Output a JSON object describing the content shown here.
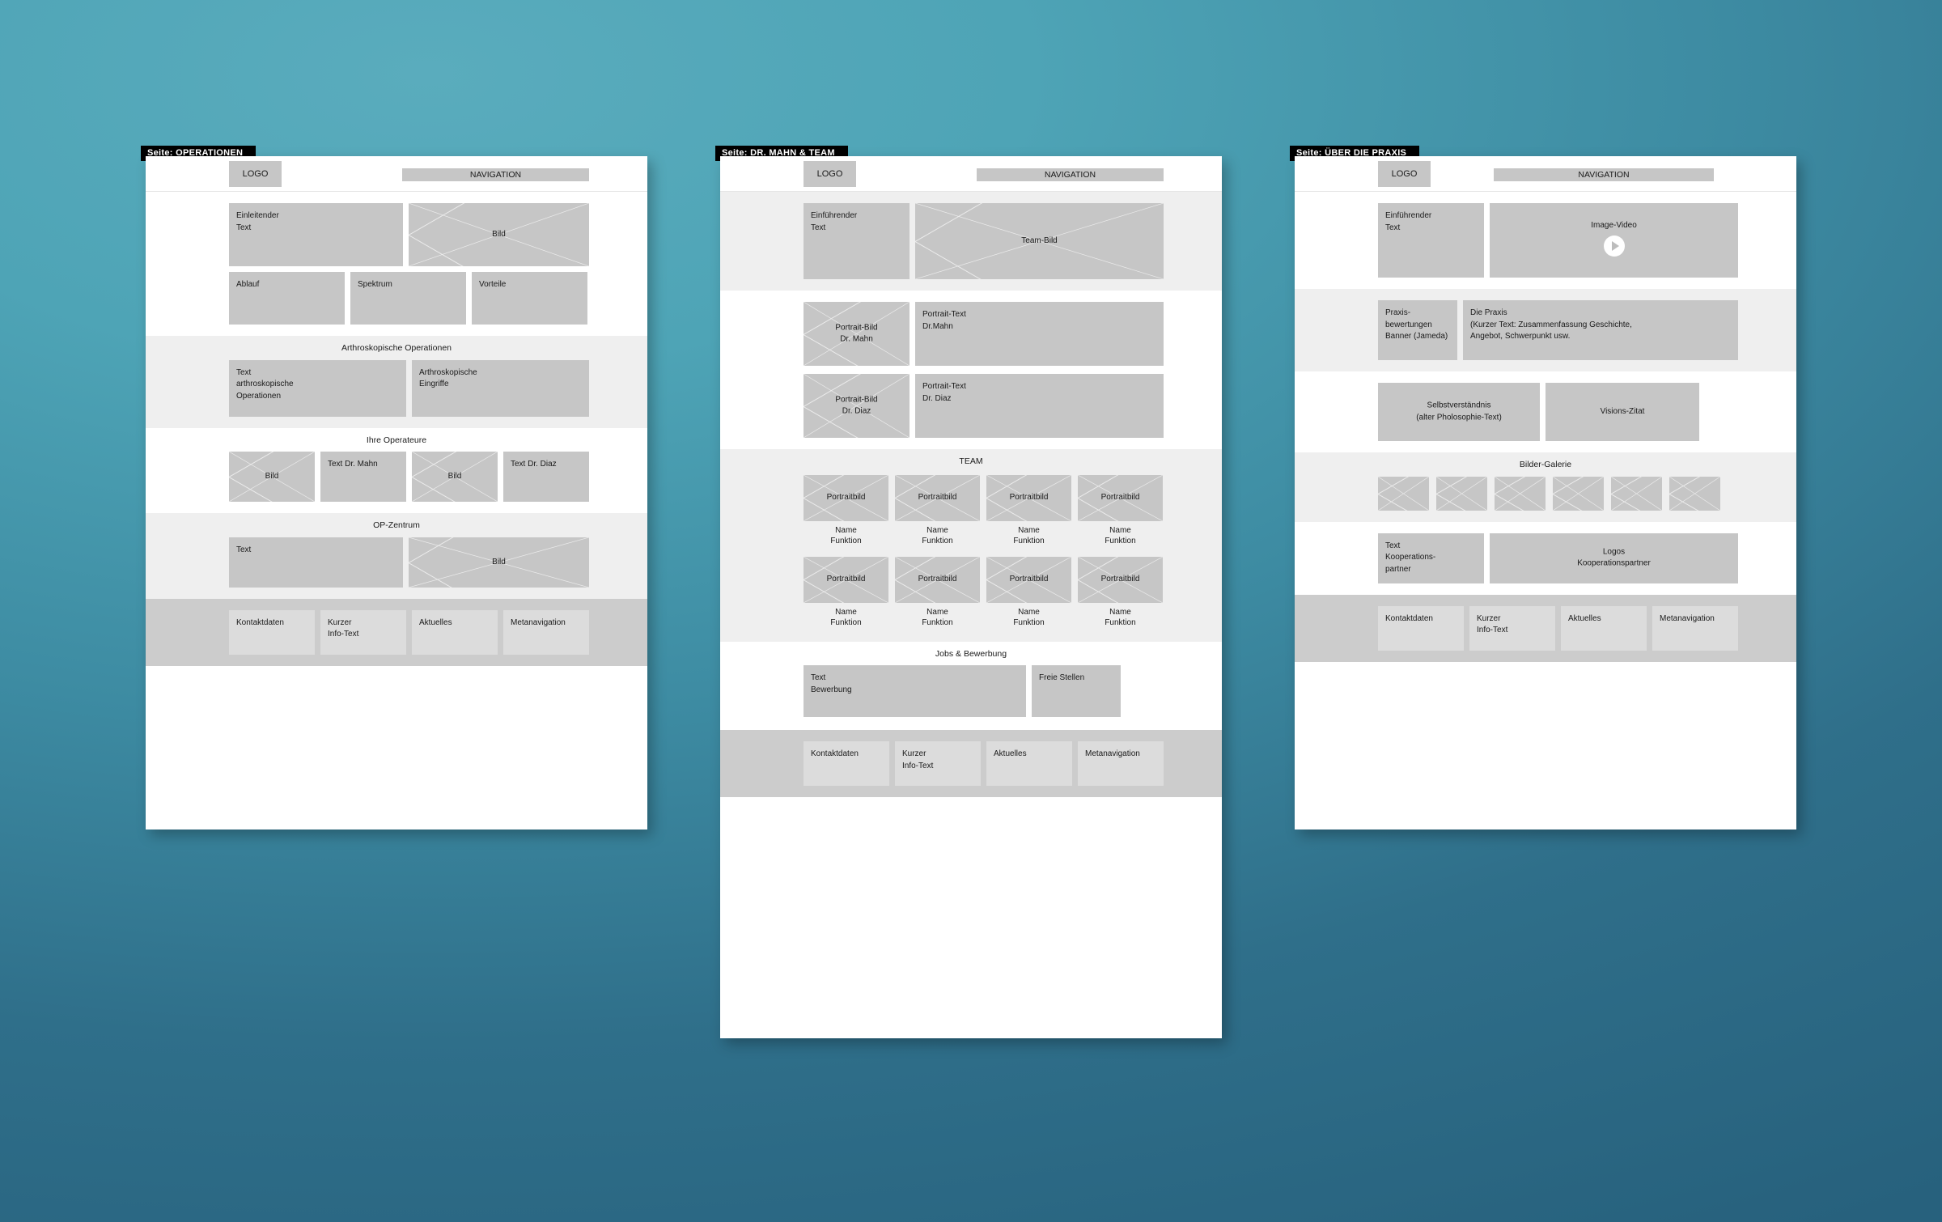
{
  "theme": {
    "background_top": "#4ea4b6",
    "background_bottom": "#27617d",
    "block_fill": "#c6c6c6",
    "band_grey": "#efefef",
    "footer_grey": "#cccccc",
    "tag_bg": "#000000"
  },
  "common": {
    "tag_prefix": "Seite:",
    "logo": "LOGO",
    "navigation": "NAVIGATION",
    "footer": [
      {
        "label": "Kontaktdaten"
      },
      {
        "label": "Kurzer\nInfo-Text"
      },
      {
        "label": "Aktuelles"
      },
      {
        "label": "Metanavigation"
      }
    ]
  },
  "boards": [
    {
      "id": "operationen",
      "tag": "OPERATIONEN",
      "sections": [
        {
          "id": "intro",
          "band": "white",
          "title": "",
          "rows": [
            {
              "blocks": [
                {
                  "label": "Einleitender\nText",
                  "type": "text",
                  "align": "topleft"
                },
                {
                  "label": "Bild",
                  "type": "image",
                  "align": "center"
                }
              ]
            },
            {
              "blocks": [
                {
                  "label": "Ablauf",
                  "type": "text",
                  "align": "topleft"
                },
                {
                  "label": "Spektrum",
                  "type": "text",
                  "align": "topleft"
                },
                {
                  "label": "Vorteile",
                  "type": "text",
                  "align": "topleft"
                }
              ]
            }
          ]
        },
        {
          "id": "arthroskopische-operationen",
          "band": "grey",
          "title": "Arthroskopische Operationen",
          "rows": [
            {
              "blocks": [
                {
                  "label": "Text\narthroskopische\nOperationen",
                  "type": "text",
                  "align": "topleft"
                },
                {
                  "label": "Arthroskopische\nEingriffe",
                  "type": "text",
                  "align": "topleft"
                }
              ]
            }
          ]
        },
        {
          "id": "ihre-operateure",
          "band": "white",
          "title": "Ihre Operateure",
          "rows": [
            {
              "blocks": [
                {
                  "label": "Bild",
                  "type": "image",
                  "align": "center"
                },
                {
                  "label": "Text Dr. Mahn",
                  "type": "text",
                  "align": "topleft"
                },
                {
                  "label": "Bild",
                  "type": "image",
                  "align": "center"
                },
                {
                  "label": "Text Dr. Diaz",
                  "type": "text",
                  "align": "topleft"
                }
              ]
            }
          ]
        },
        {
          "id": "op-zentrum",
          "band": "grey",
          "title": "OP-Zentrum",
          "rows": [
            {
              "blocks": [
                {
                  "label": "Text",
                  "type": "text",
                  "align": "topleft"
                },
                {
                  "label": "Bild",
                  "type": "image",
                  "align": "center"
                }
              ]
            }
          ]
        }
      ]
    },
    {
      "id": "dr-mahn-team",
      "tag": "DR. MAHN & TEAM",
      "sections": [
        {
          "id": "einfuehrung",
          "band": "grey",
          "title": "",
          "rows": [
            {
              "blocks": [
                {
                  "label": "Einführender\nText",
                  "type": "text",
                  "align": "topleft"
                },
                {
                  "label": "Team-Bild",
                  "type": "image",
                  "align": "center"
                }
              ]
            }
          ]
        },
        {
          "id": "portraits",
          "band": "white",
          "title": "",
          "rows": [
            {
              "blocks": [
                {
                  "label": "Portrait-Bild\nDr. Mahn",
                  "type": "image",
                  "align": "center"
                },
                {
                  "label": "Portrait-Text\nDr.Mahn",
                  "type": "text",
                  "align": "topleft"
                }
              ]
            },
            {
              "blocks": [
                {
                  "label": "Portrait-Bild\nDr. Diaz",
                  "type": "image",
                  "align": "center"
                },
                {
                  "label": "Portrait-Text\nDr. Diaz",
                  "type": "text",
                  "align": "topleft"
                }
              ]
            }
          ]
        },
        {
          "id": "team",
          "band": "grey",
          "title": "TEAM",
          "team_rows": [
            [
              {
                "image_label": "Portraitbild",
                "caption": "Name\nFunktion"
              },
              {
                "image_label": "Portraitbild",
                "caption": "Name\nFunktion"
              },
              {
                "image_label": "Portraitbild",
                "caption": "Name\nFunktion"
              },
              {
                "image_label": "Portraitbild",
                "caption": "Name\nFunktion"
              }
            ],
            [
              {
                "image_label": "Portraitbild",
                "caption": "Name\nFunktion"
              },
              {
                "image_label": "Portraitbild",
                "caption": "Name\nFunktion"
              },
              {
                "image_label": "Portraitbild",
                "caption": "Name\nFunktion"
              },
              {
                "image_label": "Portraitbild",
                "caption": "Name\nFunktion"
              }
            ]
          ]
        },
        {
          "id": "jobs-bewerbung",
          "band": "white",
          "title": "Jobs & Bewerbung",
          "rows": [
            {
              "blocks": [
                {
                  "label": "Text\nBewerbung",
                  "type": "text",
                  "align": "topleft"
                },
                {
                  "label": "Freie Stellen",
                  "type": "text",
                  "align": "topleft"
                }
              ]
            }
          ]
        }
      ]
    },
    {
      "id": "ueber-die-praxis",
      "tag": "ÜBER DIE PRAXIS",
      "sections": [
        {
          "id": "einfuehrung-video",
          "band": "white",
          "title": "",
          "rows": [
            {
              "blocks": [
                {
                  "label": "Einführender\nText",
                  "type": "text",
                  "align": "topleft"
                },
                {
                  "label": "Image-Video",
                  "type": "video",
                  "align": "center"
                }
              ]
            }
          ]
        },
        {
          "id": "die-praxis",
          "band": "grey",
          "title": "",
          "rows": [
            {
              "blocks": [
                {
                  "label": "Praxis-\nbewertungen\nBanner (Jameda)",
                  "type": "text",
                  "align": "topleft"
                },
                {
                  "label": "Die Praxis\n(Kurzer Text: Zusammenfassung Geschichte,\nAngebot, Schwerpunkt usw.",
                  "type": "text",
                  "align": "topleft"
                }
              ]
            }
          ]
        },
        {
          "id": "selbstverstaendnis",
          "band": "white",
          "title": "",
          "rows": [
            {
              "blocks": [
                {
                  "label": "Selbstverständnis\n(alter Pholosophie-Text)",
                  "type": "text",
                  "align": "center"
                },
                {
                  "label": "Visions-Zitat",
                  "type": "text",
                  "align": "center"
                }
              ]
            }
          ]
        },
        {
          "id": "bilder-galerie",
          "band": "grey",
          "title": "Bilder-Galerie",
          "gallery": [
            {
              "label": ""
            },
            {
              "label": ""
            },
            {
              "label": ""
            },
            {
              "label": ""
            },
            {
              "label": ""
            },
            {
              "label": ""
            }
          ]
        },
        {
          "id": "kooperationspartner",
          "band": "white",
          "title": "",
          "rows": [
            {
              "blocks": [
                {
                  "label": "Text\nKooperations-\npartner",
                  "type": "text",
                  "align": "topleft"
                },
                {
                  "label": "Logos\nKooperationspartner",
                  "type": "text",
                  "align": "center"
                }
              ]
            }
          ]
        }
      ]
    }
  ]
}
